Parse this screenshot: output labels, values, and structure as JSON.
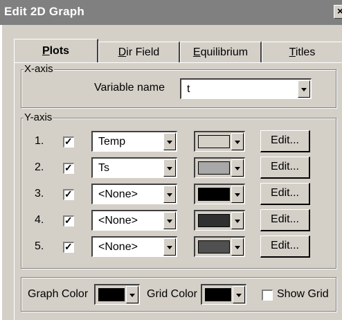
{
  "window": {
    "title": "Edit 2D Graph",
    "close_glyph": "×"
  },
  "tabs": [
    {
      "label": "Plots",
      "selected": true
    },
    {
      "label": "Dir Field",
      "selected": false
    },
    {
      "label": "Equilibrium",
      "selected": false
    },
    {
      "label": "Titles",
      "selected": false
    }
  ],
  "xaxis": {
    "legend": "X-axis",
    "variable_label": "Variable name",
    "variable_value": "t"
  },
  "yaxis": {
    "legend": "Y-axis",
    "rows": [
      {
        "num": "1.",
        "checked": true,
        "variable": "Temp",
        "color": "#d4d0c8",
        "edit_label": "Edit..."
      },
      {
        "num": "2.",
        "checked": true,
        "variable": "Ts",
        "color": "#a8a8a8",
        "edit_label": "Edit..."
      },
      {
        "num": "3.",
        "checked": true,
        "variable": "<None>",
        "color": "#000000",
        "edit_label": "Edit..."
      },
      {
        "num": "4.",
        "checked": true,
        "variable": "<None>",
        "color": "#303030",
        "edit_label": "Edit..."
      },
      {
        "num": "5.",
        "checked": true,
        "variable": "<None>",
        "color": "#505050",
        "edit_label": "Edit..."
      }
    ]
  },
  "bottom": {
    "graph_color_label": "Graph Color",
    "graph_color": "#000000",
    "grid_color_label": "Grid Color",
    "grid_color": "#000000",
    "show_grid_label": "Show Grid",
    "show_grid_checked": false
  }
}
